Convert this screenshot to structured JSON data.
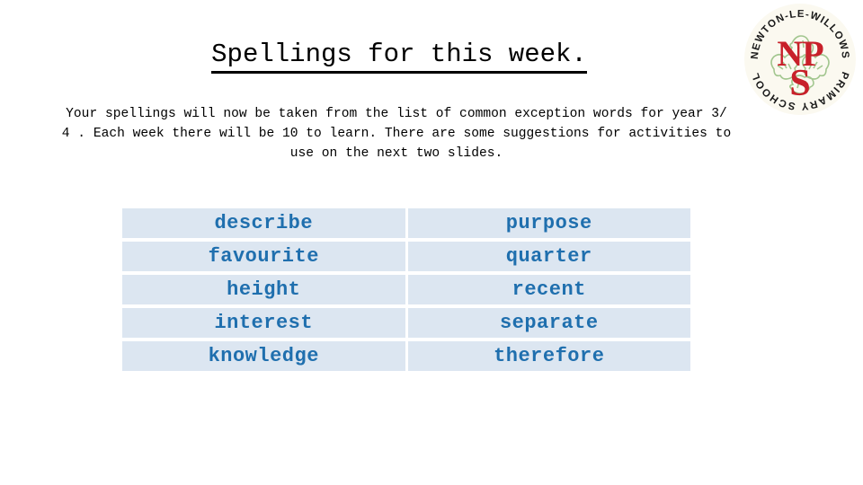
{
  "slide": {
    "title": "Spellings for this week.",
    "body": "Your spellings will now be taken from the list of common exception words for year 3/ 4 . Each week there will be 10 to learn. There are some suggestions for activities to use on the next two slides.",
    "background_color": "#ffffff"
  },
  "word_table": {
    "cell_background": "#dce6f1",
    "word_color": "#1f6fae",
    "rows": [
      {
        "left": "describe",
        "right": "purpose"
      },
      {
        "left": "favourite",
        "right": "quarter"
      },
      {
        "left": "height",
        "right": "recent"
      },
      {
        "left": "interest",
        "right": "separate"
      },
      {
        "left": "knowledge",
        "right": "therefore"
      }
    ]
  },
  "logo": {
    "name": "newton-le-willows-primary-school-logo",
    "arc_top": "NEWTON-LE-WILLOWS",
    "arc_bottom": "PRIMARY SCHOOL",
    "monogram_top": "NP",
    "monogram_bottom": "S",
    "badge_color": "#fbf9f0",
    "text_color": "#1a1a1a",
    "monogram_color": "#c8202a",
    "foliage_color": "#9ec48a"
  }
}
